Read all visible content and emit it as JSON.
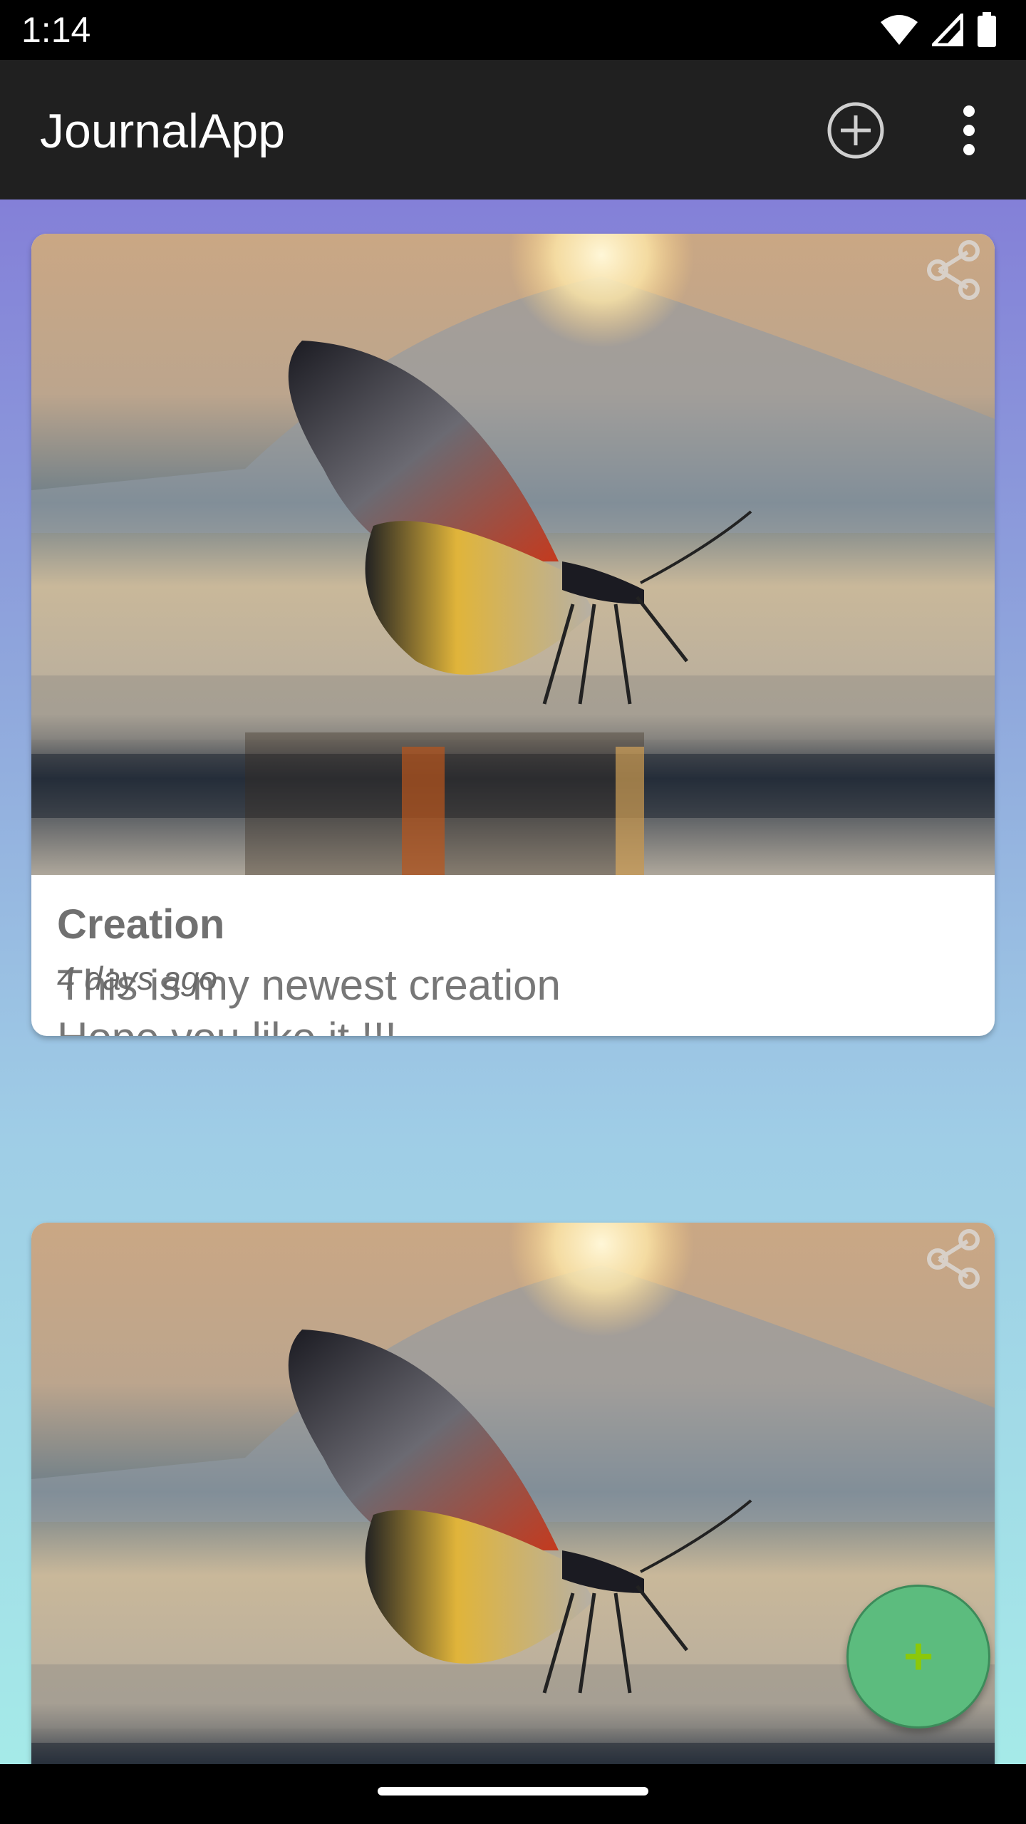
{
  "status_bar": {
    "time": "1:14",
    "icons": [
      "wifi-icon",
      "signal-icon",
      "battery-icon"
    ]
  },
  "app_bar": {
    "title": "JournalApp",
    "actions": [
      "add-circle-icon",
      "more-vert-icon"
    ]
  },
  "feed": {
    "background_colors": [
      "#8480d8",
      "#a5eae8"
    ],
    "cards": [
      {
        "image": "butterfly-sunset-image",
        "title": "Creation",
        "text": "This is my newest creation\nHope you like it !!!",
        "date": "4 days ago"
      },
      {
        "image": "butterfly-sunset-image"
      }
    ]
  },
  "fab": {
    "label": "+",
    "color": "#5cbc7e"
  }
}
